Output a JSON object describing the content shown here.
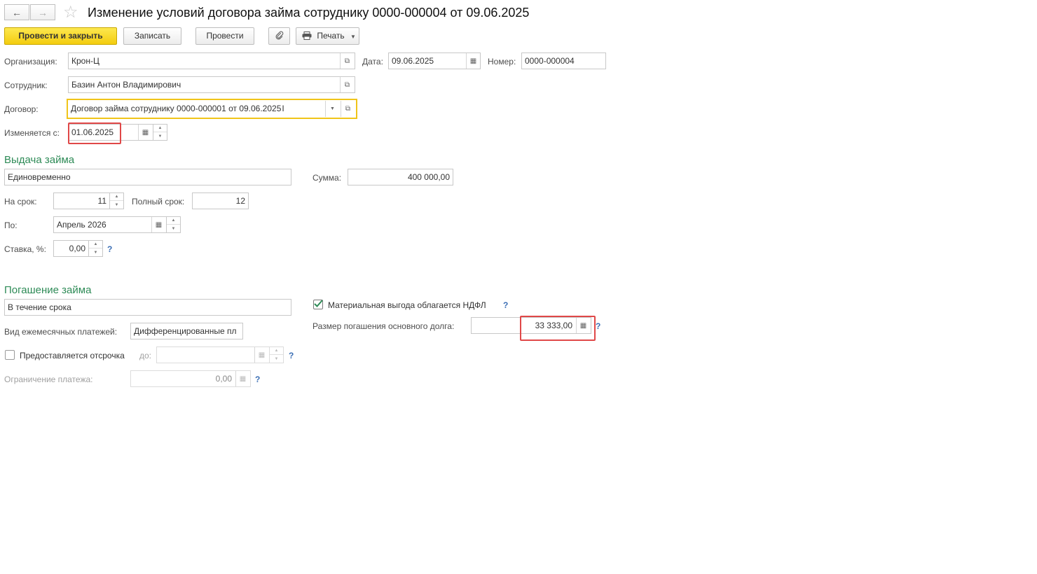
{
  "window": {
    "title": "Изменение условий договора займа сотруднику 0000-000004 от 09.06.2025"
  },
  "toolbar": {
    "post_and_close": "Провести и закрыть",
    "save": "Записать",
    "post": "Провести",
    "print": "Печать"
  },
  "header": {
    "org_label": "Организация:",
    "org_value": "Крон-Ц",
    "date_label": "Дата:",
    "date_value": "09.06.2025",
    "number_label": "Номер:",
    "number_value": "0000-000004",
    "employee_label": "Сотрудник:",
    "employee_value": "Базин Антон Владимирович",
    "contract_label": "Договор:",
    "contract_value": "Договор займа сотруднику 0000-000001 от 09.06.2025",
    "changed_from_label": "Изменяется с:",
    "changed_from_value": "01.06.2025"
  },
  "issue": {
    "title": "Выдача займа",
    "method_value": "Единовременно",
    "sum_label": "Сумма:",
    "sum_value": "400 000,00",
    "term_label": "На срок:",
    "term_value": "11",
    "full_term_label": "Полный срок:",
    "full_term_value": "12",
    "until_label": "По:",
    "until_value": "Апрель 2026",
    "rate_label": "Ставка, %:",
    "rate_value": "0,00",
    "help": "?"
  },
  "repayment": {
    "title": "Погашение займа",
    "method_value": "В течение срока",
    "ndfl_label": "Материальная выгода облагается НДФЛ",
    "ndfl_checked": true,
    "principal_label": "Размер погашения основного долга:",
    "principal_value": "33 333,00",
    "payments_type_label": "Вид ежемесячных платежей:",
    "payments_type_value": "Дифференцированные пл",
    "deferral_label": "Предоставляется отсрочка",
    "deferral_checked": false,
    "deferral_until_label": "до:",
    "limit_label": "Ограничение платежа:",
    "limit_value": "0,00",
    "help": "?"
  },
  "colors": {
    "accent_yellow": "#f5d31a",
    "section_green": "#2e8b57",
    "highlight_red": "#e04848",
    "focus_border": "#f0c419"
  }
}
